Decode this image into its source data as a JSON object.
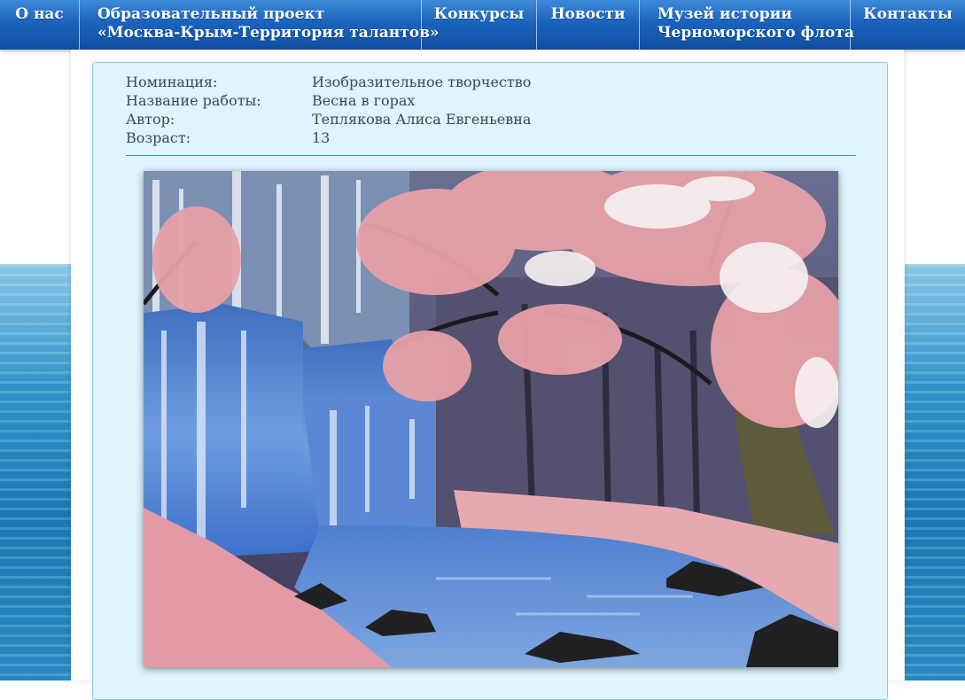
{
  "nav": {
    "items": [
      {
        "label": "О нас"
      },
      {
        "label_line1": "Образовательный проект",
        "label_line2": "«Москва-Крым-Территория талантов»"
      },
      {
        "label": "Конкурсы"
      },
      {
        "label": "Новости"
      },
      {
        "label_line1": "Музей истории",
        "label_line2": "Черноморского флота"
      },
      {
        "label": "Контакты"
      }
    ]
  },
  "entry": {
    "nomination_label": "Номинация:",
    "nomination_value": "Изобразительное творчество",
    "title_label": "Название работы:",
    "title_value": "Весна в горах",
    "author_label": "Автор:",
    "author_value": "Теплякова Алиса Евгеньевна",
    "age_label": "Возраст:",
    "age_value": "13"
  },
  "colors": {
    "nav_top": "#3f8ad8",
    "nav_bottom": "#0f4ea3",
    "card_bg": "#dff4fd",
    "divider": "#2a9bb8"
  }
}
